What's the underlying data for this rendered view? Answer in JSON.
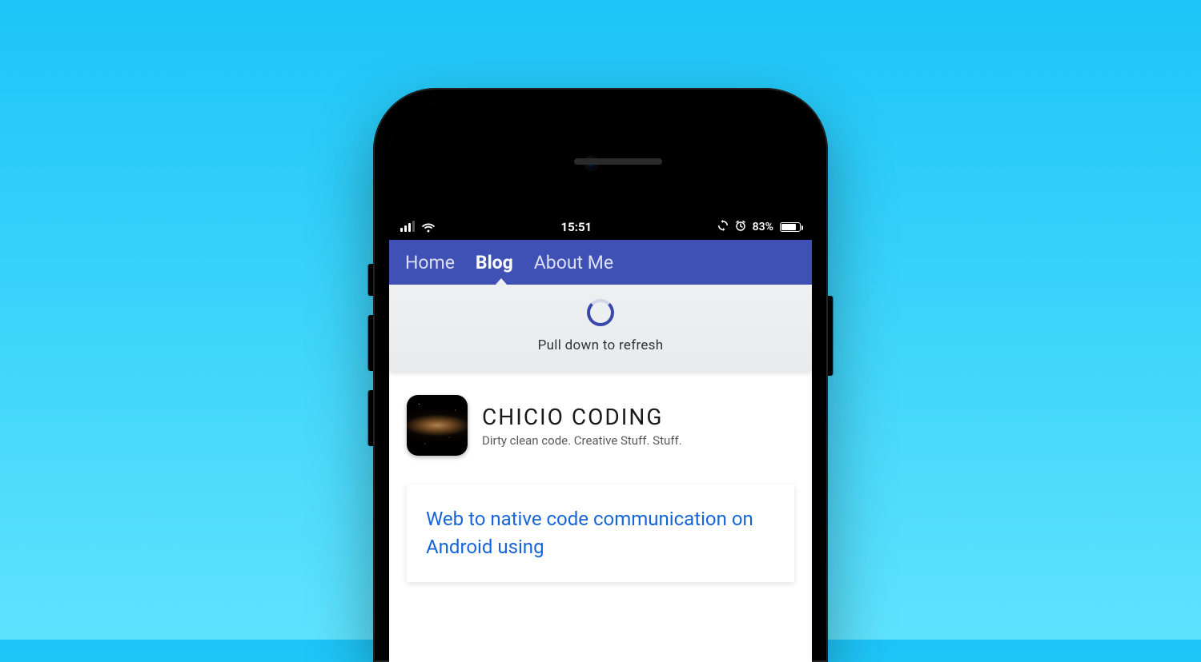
{
  "status": {
    "time": "15:51",
    "battery_pct": "83%"
  },
  "nav": {
    "items": [
      {
        "label": "Home",
        "active": false
      },
      {
        "label": "Blog",
        "active": true
      },
      {
        "label": "About Me",
        "active": false
      }
    ]
  },
  "refresh": {
    "text": "Pull down to refresh"
  },
  "blog": {
    "title": "CHICIO CODING",
    "tagline": "Dirty clean code. Creative Stuff. Stuff."
  },
  "post": {
    "title": "Web to native code communication on Android using"
  }
}
